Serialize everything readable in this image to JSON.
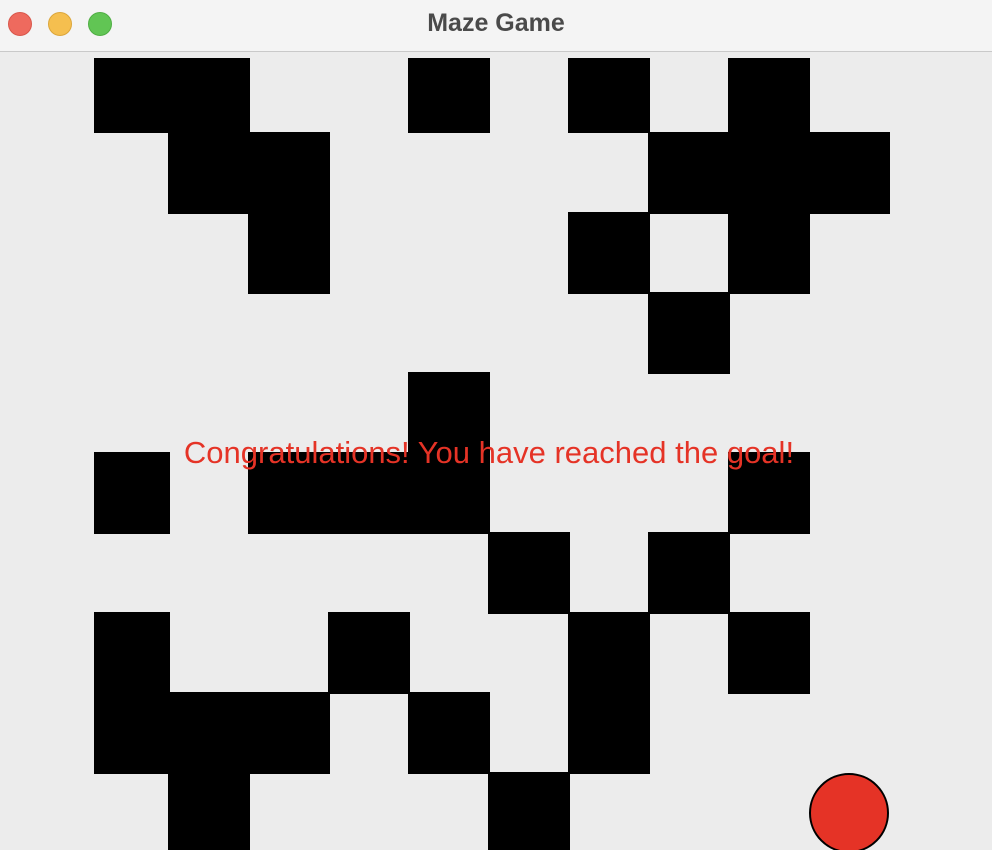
{
  "window": {
    "title": "Maze Game",
    "controls": [
      "close-button",
      "minimize-button",
      "maximize-button"
    ]
  },
  "game": {
    "message": "Congratulations! You have reached the goal!",
    "colors": {
      "background": "#ececec",
      "wall": "#000000",
      "player": "#e53326",
      "message": "#e53326"
    },
    "player_icon": "red-circle"
  }
}
